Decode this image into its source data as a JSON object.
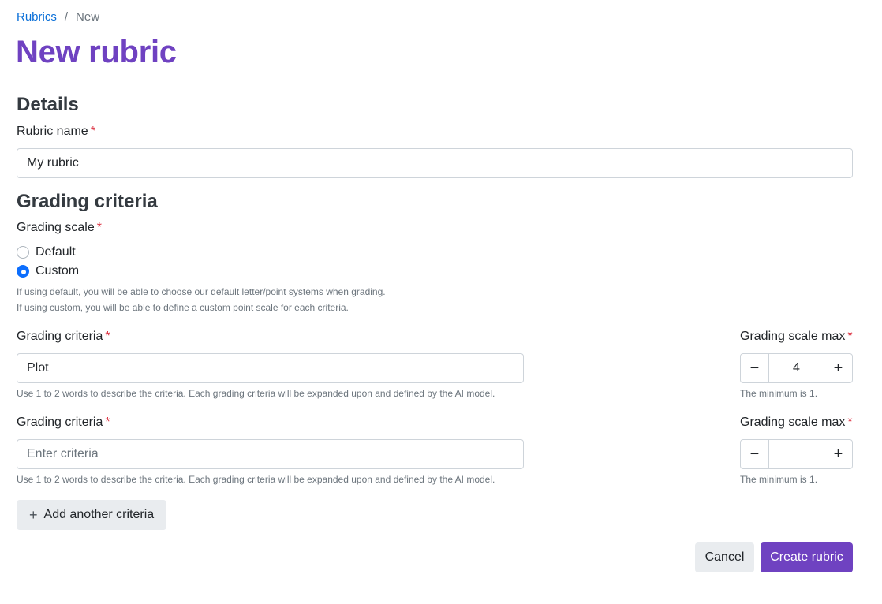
{
  "breadcrumb": {
    "parent": "Rubrics",
    "separator": "/",
    "current": "New"
  },
  "title": "New rubric",
  "details": {
    "heading": "Details",
    "name_label": "Rubric name",
    "required_mark": "*",
    "name_value": "My rubric"
  },
  "grading": {
    "heading": "Grading criteria",
    "scale_label": "Grading scale",
    "options": [
      {
        "label": "Default",
        "selected": false
      },
      {
        "label": "Custom",
        "selected": true
      }
    ],
    "help_lines": [
      "If using default, you will be able to choose our default letter/point systems when grading.",
      "If using custom, you will be able to define a custom point scale for each criteria."
    ],
    "criteria": [
      {
        "label": "Grading criteria",
        "value": "Plot",
        "placeholder": "Enter criteria",
        "help": "Use 1 to 2 words to describe the criteria. Each grading criteria will be expanded upon and defined by the AI model.",
        "max_label": "Grading scale max",
        "max_value": "4",
        "max_help": "The minimum is 1."
      },
      {
        "label": "Grading criteria",
        "value": "",
        "placeholder": "Enter criteria",
        "help": "Use 1 to 2 words to describe the criteria. Each grading criteria will be expanded upon and defined by the AI model.",
        "max_label": "Grading scale max",
        "max_value": "",
        "max_help": "The minimum is 1."
      }
    ],
    "stepper_minus": "−",
    "stepper_plus": "+",
    "add_label": "Add another criteria",
    "add_icon": "+"
  },
  "actions": {
    "cancel": "Cancel",
    "create": "Create rubric"
  },
  "colors": {
    "brand": "#6f42c1",
    "link": "#0a6fd8",
    "radio_selected": "#0d6efd",
    "required": "#dc3545"
  }
}
